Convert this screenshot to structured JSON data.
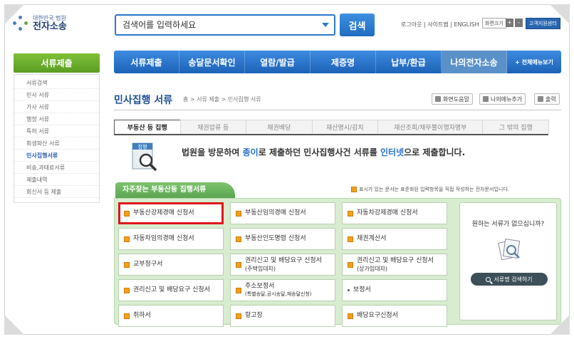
{
  "header": {
    "logo_top": "대한민국 법원",
    "logo_bottom": "전자소송",
    "search_placeholder": "검색어를 입력하세요",
    "search_button": "검색",
    "util_links": "로그아웃 | 사이트맵 | ENGLISH",
    "font_size_label": "화면크기",
    "font_plus": "+",
    "font_minus": "-",
    "support_button": "고객지원센터"
  },
  "sidebar": {
    "title": "서류제출",
    "items": [
      {
        "label": "서류검색"
      },
      {
        "label": "민사 서류"
      },
      {
        "label": "가사 서류"
      },
      {
        "label": "행정 서류"
      },
      {
        "label": "특허 서류"
      },
      {
        "label": "회생파산 서류"
      },
      {
        "label": "민사집행서류"
      },
      {
        "label": "비송,과태료서류"
      },
      {
        "label": "제출내역"
      },
      {
        "label": "회신서 등 제출"
      }
    ]
  },
  "gnb": {
    "items": [
      {
        "label": "서류제출"
      },
      {
        "label": "송달문서확인"
      },
      {
        "label": "열람/발급"
      },
      {
        "label": "제증명"
      },
      {
        "label": "납부/환급"
      },
      {
        "label": "나의전자소송"
      }
    ],
    "all_menu": "+ 전체메뉴보기"
  },
  "page": {
    "title": "민사집행 서류",
    "breadcrumb": "홈 > 서류 제출 > 민사집행 서류",
    "tools": {
      "help": "화면도움말",
      "my_menu": "나의메뉴추가",
      "print": "출력"
    }
  },
  "tabs": [
    {
      "label": "부동산 등 집행"
    },
    {
      "label": "채권압류 등"
    },
    {
      "label": "채권배당"
    },
    {
      "label": "재산명시/감치"
    },
    {
      "label": "재산조회/채무불이행자명부"
    },
    {
      "label": "그 밖의 집행"
    }
  ],
  "intro": {
    "icon_label": "집행",
    "part1": "법원을 방문하여 ",
    "hl1": "종이",
    "part2": "로 제출하던 민사집행사건 서류를 ",
    "hl2": "인터넷",
    "part3": "으로 제출합니다."
  },
  "panel": {
    "title": "자주찾는 부동산등 집행서류",
    "legend": "표시가 있는 문서는 표준화된 입력항목을 직접 작성하는 전자문서입니다.",
    "cells": [
      {
        "line1": "부동산강제경매 신청서",
        "line2": ""
      },
      {
        "line1": "부동산임의경매 신청서",
        "line2": ""
      },
      {
        "line1": "자동차강제경매 신청서",
        "line2": ""
      },
      {
        "line1": "자동차임의경매 신청서",
        "line2": ""
      },
      {
        "line1": "부동산인도명령 신청서",
        "line2": ""
      },
      {
        "line1": "채권계산서",
        "line2": ""
      },
      {
        "line1": "교부청구서",
        "line2": ""
      },
      {
        "line1": "권리신고 및 배당요구 신청서",
        "line2": "(주택임대차)"
      },
      {
        "line1": "권리신고 및 배당요구 신청서",
        "line2": "(상가임대차)"
      },
      {
        "line1": "권리신고 및 배당요구 신청서",
        "line2": ""
      },
      {
        "line1": "주소보정서",
        "line2": "(특별송달,공시송달,재송달신청)"
      },
      {
        "line1": "보정서",
        "line2": ""
      },
      {
        "line1": "취하서",
        "line2": ""
      },
      {
        "line1": "항고장",
        "line2": ""
      },
      {
        "line1": "배당요구신청서",
        "line2": ""
      }
    ],
    "side_question": "원하는 서류가 없으십니까?",
    "side_button": "서류명 검색하기"
  },
  "colors": {
    "accent_blue": "#2a79c9",
    "green": "#6ab35e",
    "highlight_red": "#e0161c"
  }
}
